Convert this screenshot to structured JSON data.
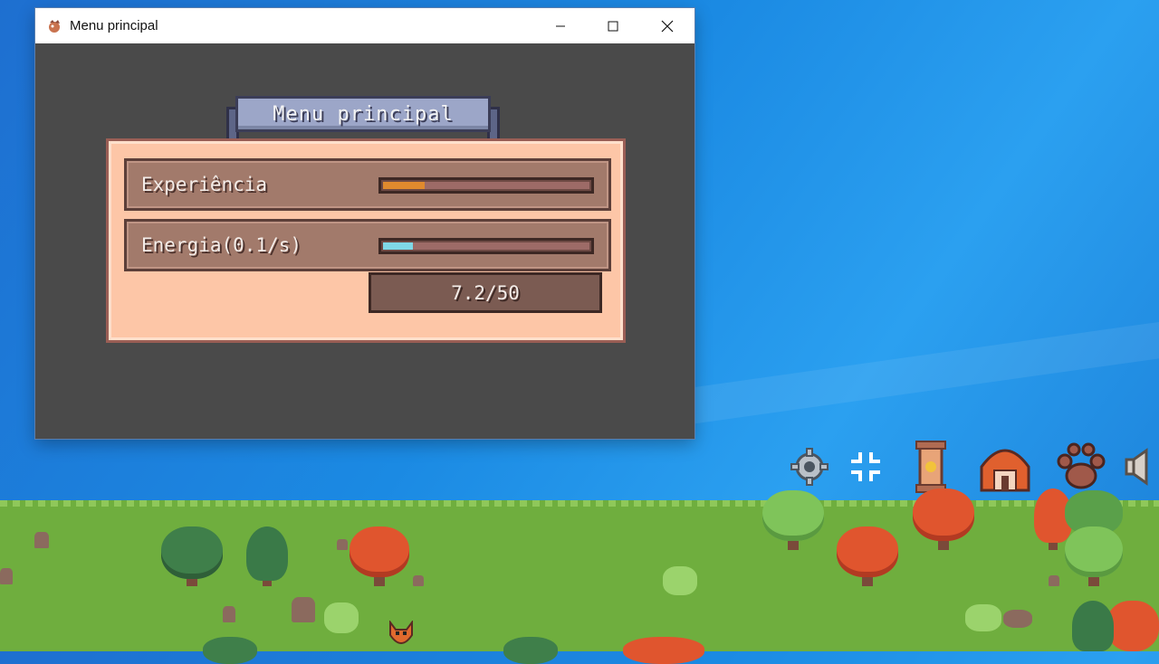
{
  "window": {
    "title": "Menu principal"
  },
  "game": {
    "banner": "Menu principal",
    "rows": [
      {
        "label": "Experiência",
        "progress": 0.2
      },
      {
        "label": "Energia(0.1/s)",
        "progress": 0.144
      }
    ],
    "energy_counter": "7.2/50"
  },
  "colors": {
    "desktop": "#1b8ae3",
    "panel": "#fdc6a7",
    "row": "#a27a6b",
    "exp_fill": "#e08a2e",
    "energy_fill": "#7fd8e6",
    "banner": "#9ca6c8"
  },
  "desktop_icons": [
    "gear-icon",
    "fullscreen-icon",
    "scroll-icon",
    "house-icon",
    "paw-icon",
    "speaker-icon"
  ]
}
